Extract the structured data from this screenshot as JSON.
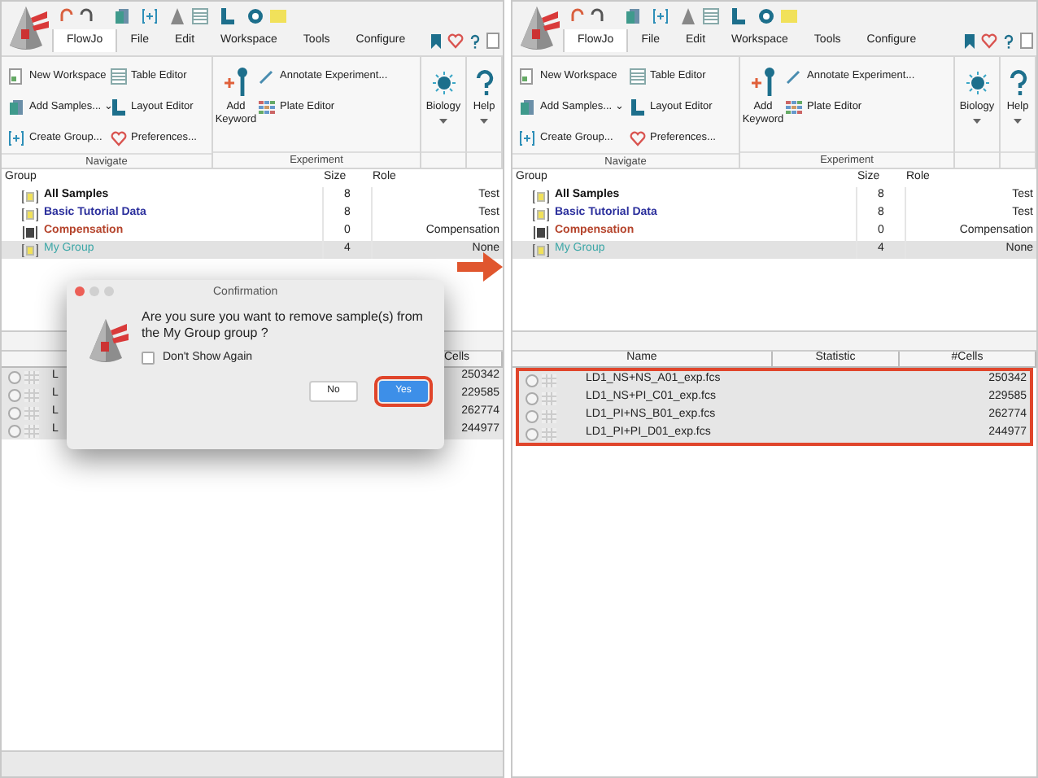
{
  "panels": [
    {
      "menu": [
        {
          "label": "FlowJo",
          "selected": true
        },
        {
          "label": "File",
          "selected": false
        },
        {
          "label": "Edit",
          "selected": false
        },
        {
          "label": "Workspace",
          "selected": false
        },
        {
          "label": "Tools",
          "selected": false
        },
        {
          "label": "Configure",
          "selected": false
        }
      ],
      "ribbon": {
        "navigate": {
          "label": "Navigate",
          "items": [
            "New Workspace",
            "Add Samples... ⌄",
            "Create Group...",
            "Table Editor",
            "Layout Editor",
            "Preferences..."
          ]
        },
        "experiment": {
          "label": "Experiment",
          "big": "Add Keyword",
          "items": [
            "Annotate Experiment...",
            "Plate Editor"
          ]
        },
        "biology": "Biology",
        "help": "Help"
      },
      "group_table": {
        "columns": [
          "Group",
          "Size",
          "Role"
        ],
        "rows": [
          {
            "name": "All Samples",
            "size": "8",
            "role": "Test",
            "color": "#111111",
            "selected": false
          },
          {
            "name": "Basic Tutorial Data",
            "size": "8",
            "role": "Test",
            "color": "#2b2f9c",
            "selected": false
          },
          {
            "name": "Compensation",
            "size": "0",
            "role": "Compensation",
            "color": "#b5442c",
            "selected": false
          },
          {
            "name": "My Group",
            "size": "4",
            "role": "None",
            "color": "#3aa6a6",
            "selected": true
          }
        ]
      },
      "sample_table": {
        "columns": [
          "Cells"
        ],
        "highlighted": false,
        "rows": [
          {
            "name": "L",
            "cells": "250342"
          },
          {
            "name": "L",
            "cells": "229585"
          },
          {
            "name": "L",
            "cells": "262774"
          },
          {
            "name": "L",
            "cells": "244977"
          }
        ]
      },
      "dialog": {
        "title": "Confirmation",
        "message": "Are you sure you want to remove sample(s) from the My Group group ?",
        "checkbox": {
          "label": "Don't Show Again",
          "checked": false
        },
        "buttons": [
          {
            "label": "No",
            "primary": false,
            "highlighted": false
          },
          {
            "label": "Yes",
            "primary": true,
            "highlighted": true
          }
        ]
      }
    },
    {
      "menu": [
        {
          "label": "FlowJo",
          "selected": true
        },
        {
          "label": "File",
          "selected": false
        },
        {
          "label": "Edit",
          "selected": false
        },
        {
          "label": "Workspace",
          "selected": false
        },
        {
          "label": "Tools",
          "selected": false
        },
        {
          "label": "Configure",
          "selected": false
        }
      ],
      "ribbon": {
        "navigate": {
          "label": "Navigate",
          "items": [
            "New Workspace",
            "Add Samples... ⌄",
            "Create Group...",
            "Table Editor",
            "Layout Editor",
            "Preferences..."
          ]
        },
        "experiment": {
          "label": "Experiment",
          "big": "Add Keyword",
          "items": [
            "Annotate Experiment...",
            "Plate Editor"
          ]
        },
        "biology": "Biology",
        "help": "Help"
      },
      "group_table": {
        "columns": [
          "Group",
          "Size",
          "Role"
        ],
        "rows": [
          {
            "name": "All Samples",
            "size": "8",
            "role": "Test",
            "color": "#111111",
            "selected": false
          },
          {
            "name": "Basic Tutorial Data",
            "size": "8",
            "role": "Test",
            "color": "#2b2f9c",
            "selected": false
          },
          {
            "name": "Compensation",
            "size": "0",
            "role": "Compensation",
            "color": "#b5442c",
            "selected": false
          },
          {
            "name": "My Group",
            "size": "4",
            "role": "None",
            "color": "#3aa6a6",
            "selected": true
          }
        ]
      },
      "sample_table": {
        "columns": [
          "Name",
          "Statistic",
          "#Cells"
        ],
        "highlighted": true,
        "rows": [
          {
            "name": "LD1_NS+NS_A01_exp.fcs",
            "cells": "250342"
          },
          {
            "name": "LD1_NS+PI_C01_exp.fcs",
            "cells": "229585"
          },
          {
            "name": "LD1_PI+NS_B01_exp.fcs",
            "cells": "262774"
          },
          {
            "name": "LD1_PI+PI_D01_exp.fcs",
            "cells": "244977"
          }
        ]
      }
    }
  ],
  "arrow": true
}
